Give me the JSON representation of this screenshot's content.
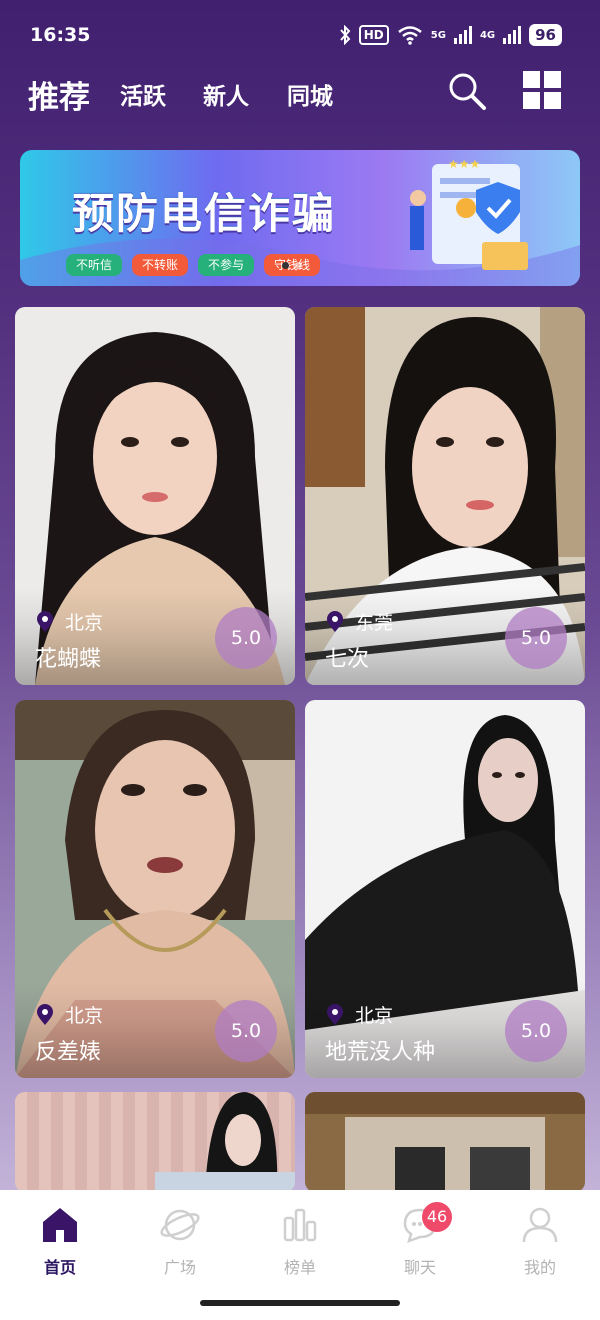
{
  "status_bar": {
    "time": "16:35",
    "hd": "HD",
    "net_5g": "5G",
    "net_4g": "4G",
    "battery": "96"
  },
  "top_nav": {
    "tabs": [
      {
        "label": "推荐",
        "active": true
      },
      {
        "label": "活跃",
        "active": false
      },
      {
        "label": "新人",
        "active": false
      },
      {
        "label": "同城",
        "active": false
      }
    ],
    "search_icon": "search-icon",
    "grid_icon": "grid-icon"
  },
  "banner": {
    "title": "预防电信诈骗",
    "chips": [
      "不听信",
      "不转账",
      "不参与",
      "守钱线"
    ],
    "chip_colors": [
      "#26b07a",
      "#f25a3a",
      "#26b07a",
      "#f25a3a"
    ]
  },
  "cards": [
    {
      "city": "北京",
      "name": "花蝴蝶",
      "score": "5.0"
    },
    {
      "city": "东莞",
      "name": "七次",
      "score": "5.0"
    },
    {
      "city": "北京",
      "name": "反差婊",
      "score": "5.0"
    },
    {
      "city": "北京",
      "name": "地荒没人种",
      "score": "5.0"
    },
    {
      "city": "",
      "name": "",
      "score": ""
    },
    {
      "city": "",
      "name": "",
      "score": ""
    }
  ],
  "bottom_nav": [
    {
      "label": "首页",
      "icon": "home-icon",
      "active": true
    },
    {
      "label": "广场",
      "icon": "planet-icon",
      "active": false
    },
    {
      "label": "榜单",
      "icon": "chart-icon",
      "active": false
    },
    {
      "label": "聊天",
      "icon": "chat-icon",
      "active": false,
      "badge": "46"
    },
    {
      "label": "我的",
      "icon": "user-icon",
      "active": false
    }
  ],
  "colors": {
    "accent": "#3a1466",
    "badge": "#ef4a6a",
    "score_bubble": "#b07ec4"
  }
}
